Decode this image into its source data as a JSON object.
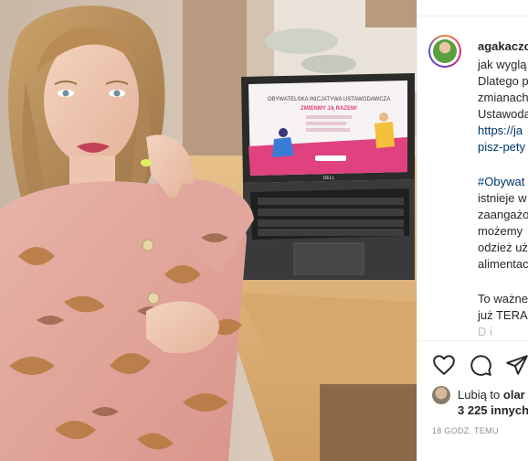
{
  "post": {
    "username": "agakaczo",
    "caption_lines": [
      "jak wyglą",
      "Dlatego p",
      "zmianach",
      "Ustawoda",
      "https://ja",
      "pisz-pety"
    ],
    "hashtag_line": "#Obywat",
    "caption_lines_2": [
      "istnieje w",
      "zaangażo",
      "możemy",
      "odzież uż",
      "alimentac"
    ],
    "caption_lines_3": [
      "To ważne",
      "już TERAZ"
    ],
    "faded_line": "D      i"
  },
  "likes": {
    "prefix": "Lubią to",
    "liker": "olar",
    "count": "3 225 innych"
  },
  "timestamp": "18 GODZ. TEMU",
  "icons": {
    "like": "heart-icon",
    "comment": "comment-icon",
    "share": "send-icon"
  },
  "laptop_screen": {
    "headline": "OBYWATELSKA INICJATYWA USTAWODAWCZA",
    "subline": "ZMIENMY JĄ RAZEM!",
    "brand": "DELL"
  },
  "colors": {
    "accent_pink": "#e0427f",
    "link_blue": "#00376b",
    "text": "#262626",
    "muted": "#8e8e8e"
  }
}
